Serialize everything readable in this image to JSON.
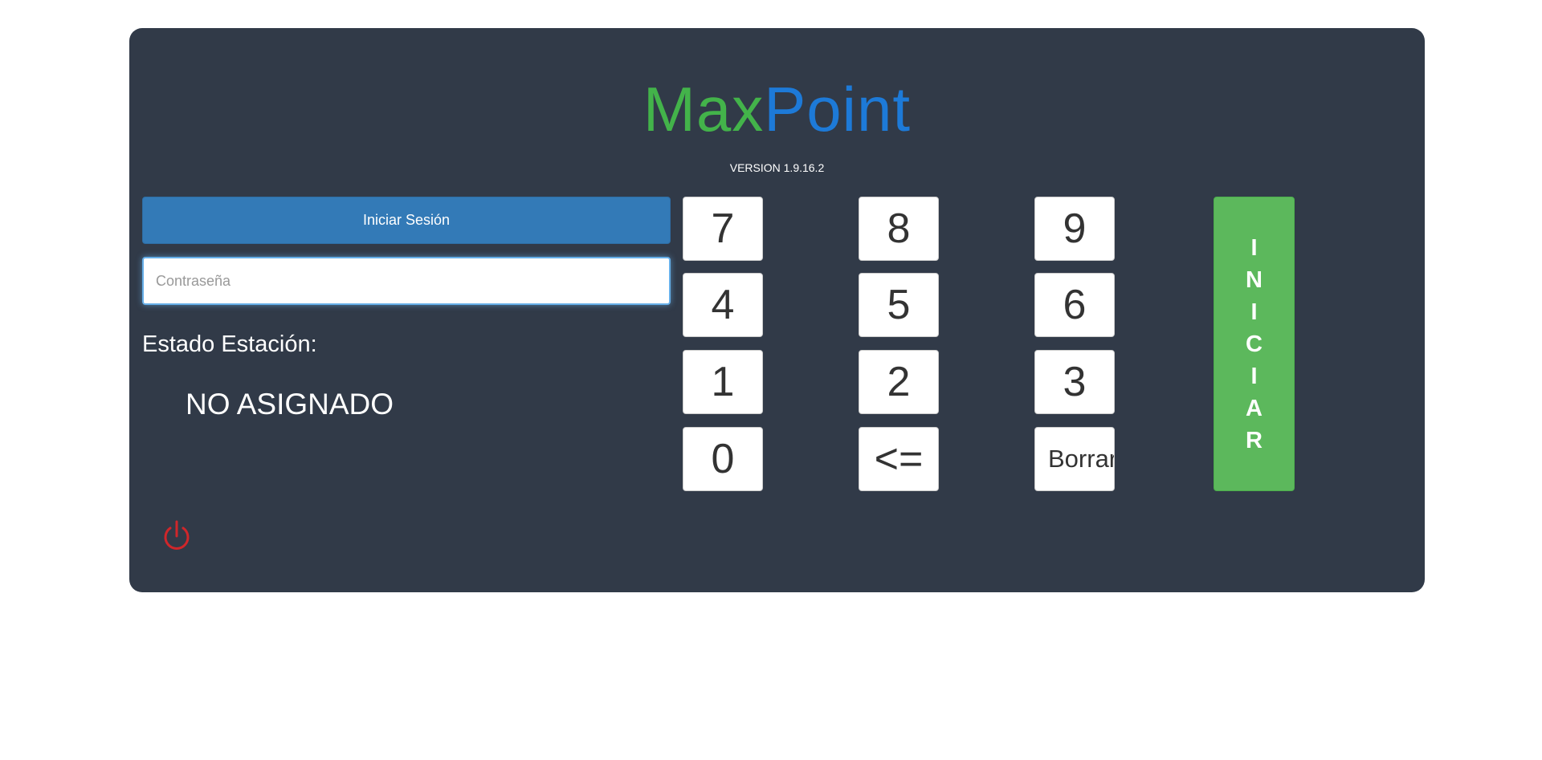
{
  "brand": {
    "part1": "Max",
    "part2": "Point",
    "color1": "#43b34a",
    "color2": "#1d7ad8"
  },
  "version": "VERSION 1.9.16.2",
  "login": {
    "button_label": "Iniciar Sesión",
    "password_placeholder": "Contraseña",
    "password_value": ""
  },
  "status": {
    "label": "Estado Estación:",
    "value": "NO ASIGNADO"
  },
  "keypad": {
    "k7": "7",
    "k8": "8",
    "k9": "9",
    "k4": "4",
    "k5": "5",
    "k6": "6",
    "k1": "1",
    "k2": "2",
    "k3": "3",
    "k0": "0",
    "back": "<=",
    "clear": "Borrar"
  },
  "iniciar": {
    "letters": [
      "I",
      "N",
      "I",
      "C",
      "I",
      "A",
      "R"
    ],
    "color": "#5cb85c"
  },
  "power": {
    "icon": "power-icon",
    "color": "#d0262a"
  }
}
